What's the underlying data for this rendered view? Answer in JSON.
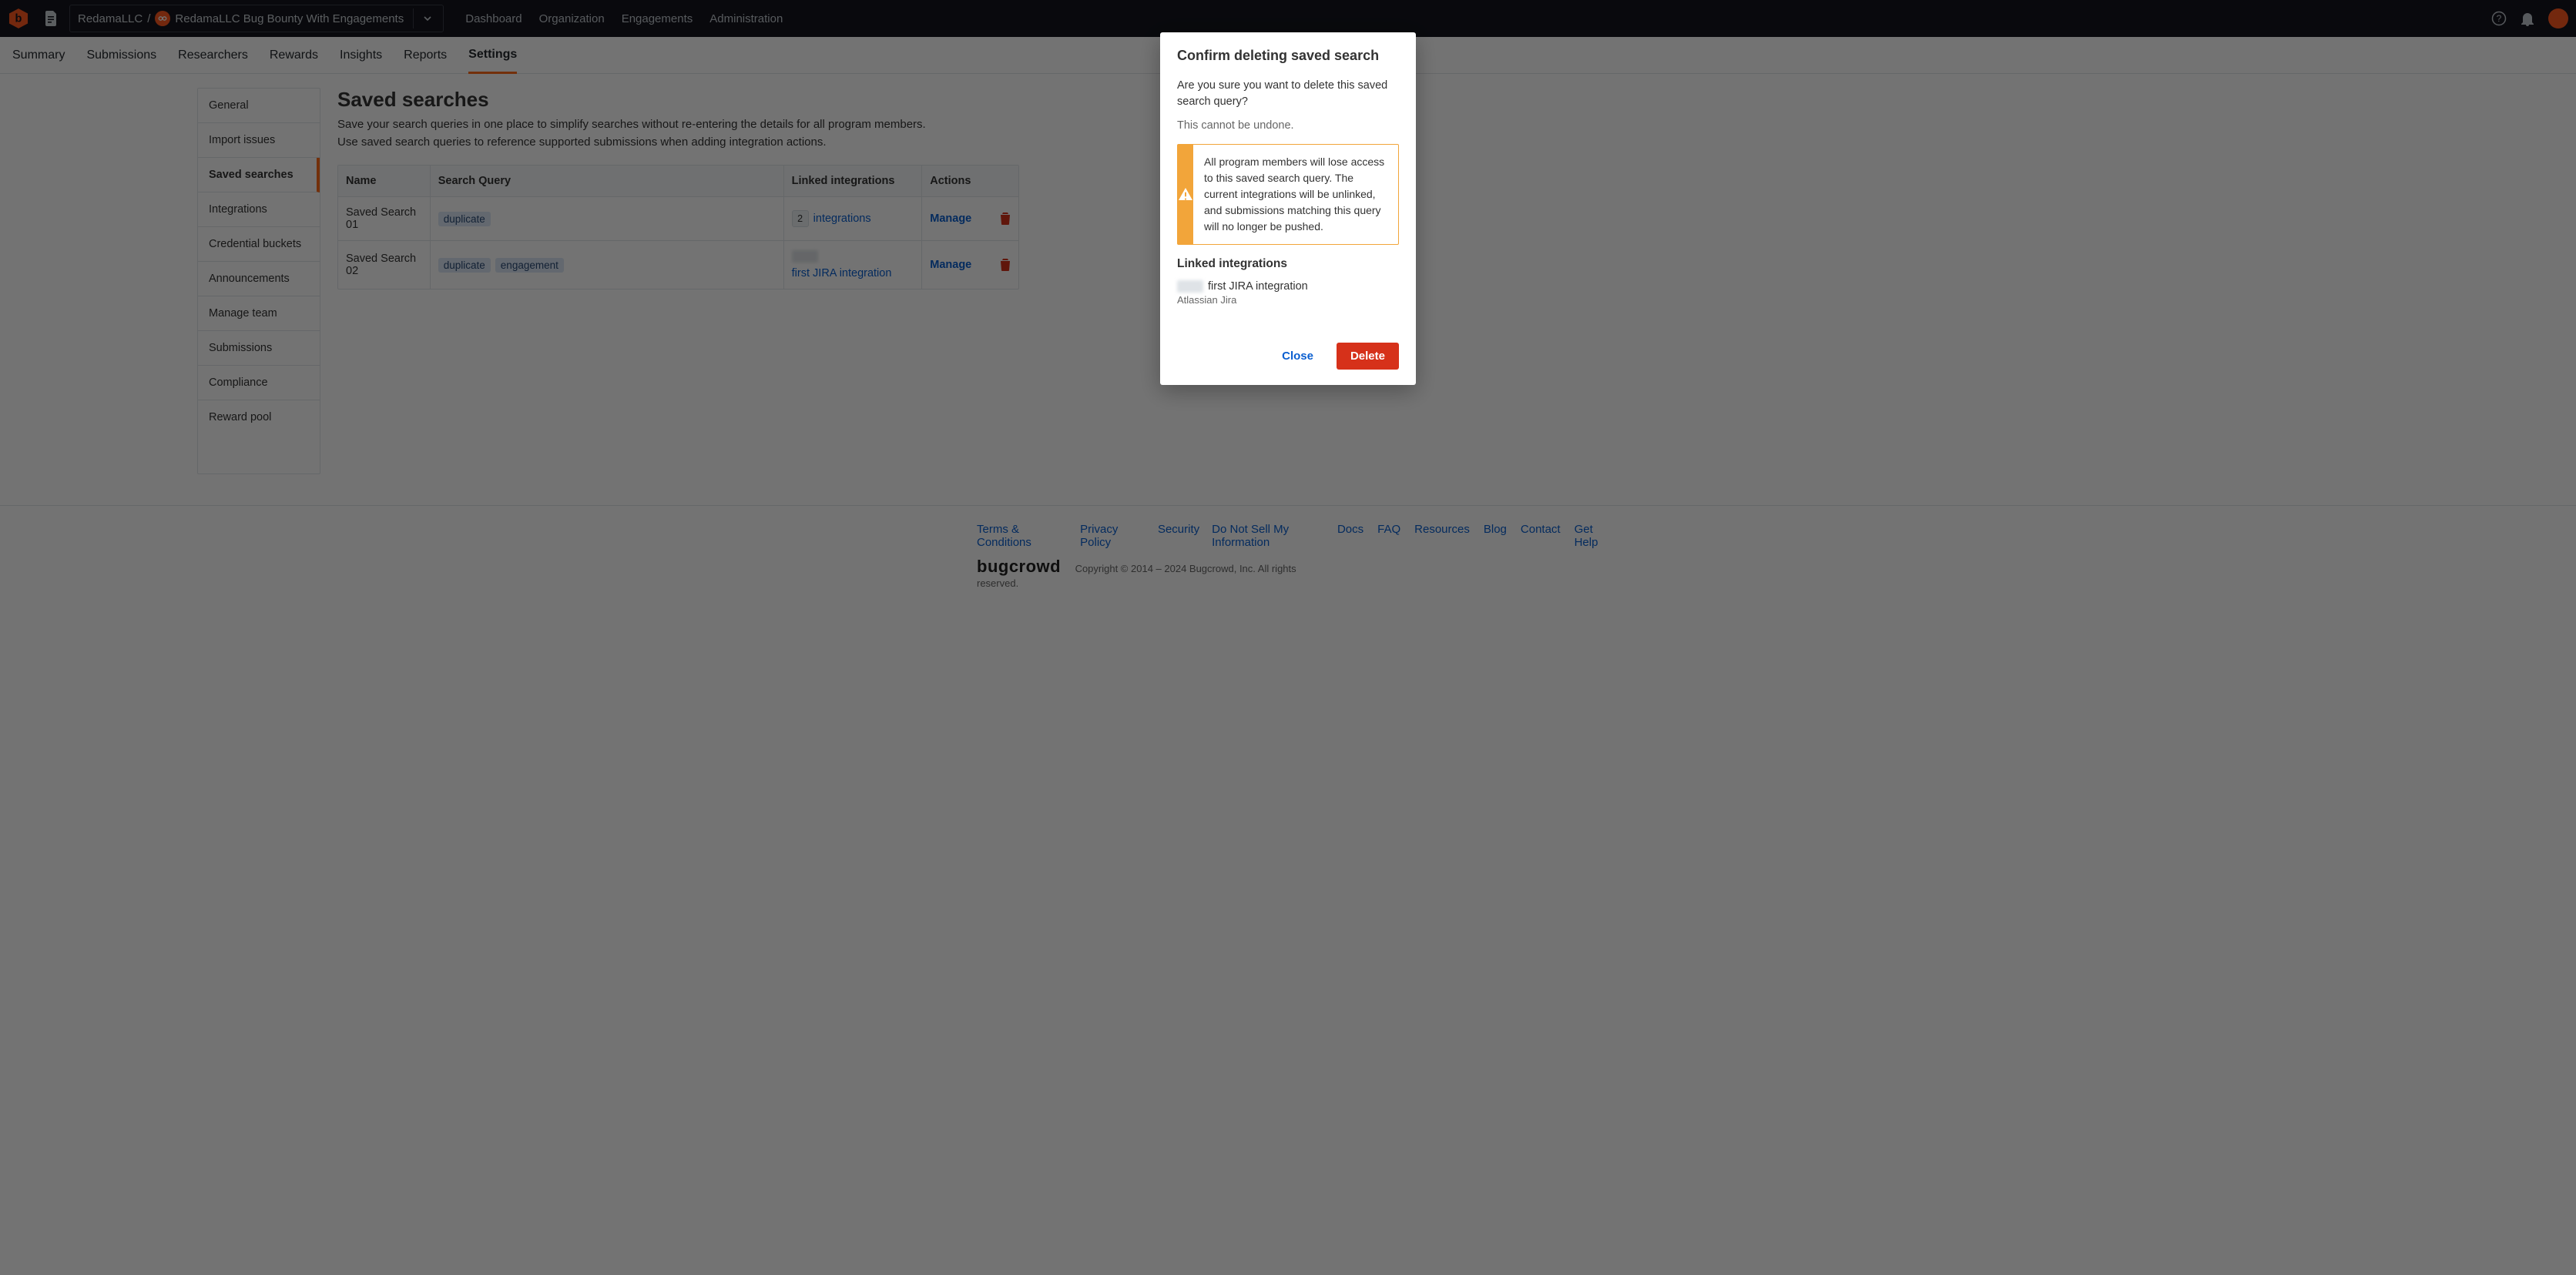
{
  "topbar": {
    "breadcrumb_org": "RedamaLLC",
    "breadcrumb_sep": "/",
    "breadcrumb_program": "RedamaLLC Bug Bounty With Engagements",
    "nav": [
      "Dashboard",
      "Organization",
      "Engagements",
      "Administration"
    ]
  },
  "tabs": [
    "Summary",
    "Submissions",
    "Researchers",
    "Rewards",
    "Insights",
    "Reports",
    "Settings"
  ],
  "active_tab": "Settings",
  "sidebar": {
    "items": [
      "General",
      "Import issues",
      "Saved searches",
      "Integrations",
      "Credential buckets",
      "Announcements",
      "Manage team",
      "Submissions",
      "Compliance",
      "Reward pool"
    ],
    "active": "Saved searches"
  },
  "page": {
    "title": "Saved searches",
    "desc_line1": "Save your search queries in one place to simplify searches without re-entering the details for all program members.",
    "desc_line2": "Use saved search queries to reference supported submissions when adding integration actions."
  },
  "table": {
    "headers": {
      "name": "Name",
      "query": "Search Query",
      "linked": "Linked integrations",
      "actions": "Actions"
    },
    "rows": [
      {
        "name": "Saved Search 01",
        "query_chips": [
          "duplicate"
        ],
        "linked_kind": "count",
        "linked_count": "2",
        "linked_label": "integrations",
        "manage": "Manage"
      },
      {
        "name": "Saved Search 02",
        "query_chips": [
          "duplicate",
          "engagement"
        ],
        "linked_kind": "single",
        "linked_label": "first JIRA integration",
        "manage": "Manage"
      }
    ]
  },
  "dialog": {
    "title": "Confirm deleting saved search",
    "question": "Are you sure you want to delete this saved search query?",
    "undone": "This cannot be undone.",
    "alert": "All program members will lose access to this saved search query. The current integrations will be unlinked, and submissions matching this query will no longer be pushed.",
    "linked_heading": "Linked integrations",
    "linked_item_name": "first JIRA integration",
    "linked_item_sub": "Atlassian Jira",
    "close": "Close",
    "delete": "Delete"
  },
  "footer": {
    "left_links": [
      "Terms & Conditions",
      "Privacy Policy",
      "Security",
      "Do Not Sell My Information"
    ],
    "brand": "bugcrowd",
    "copyright": "Copyright © 2014 – 2024 Bugcrowd, Inc. All rights reserved.",
    "right_links": [
      "Docs",
      "FAQ",
      "Resources",
      "Blog",
      "Contact",
      "Get Help"
    ]
  }
}
